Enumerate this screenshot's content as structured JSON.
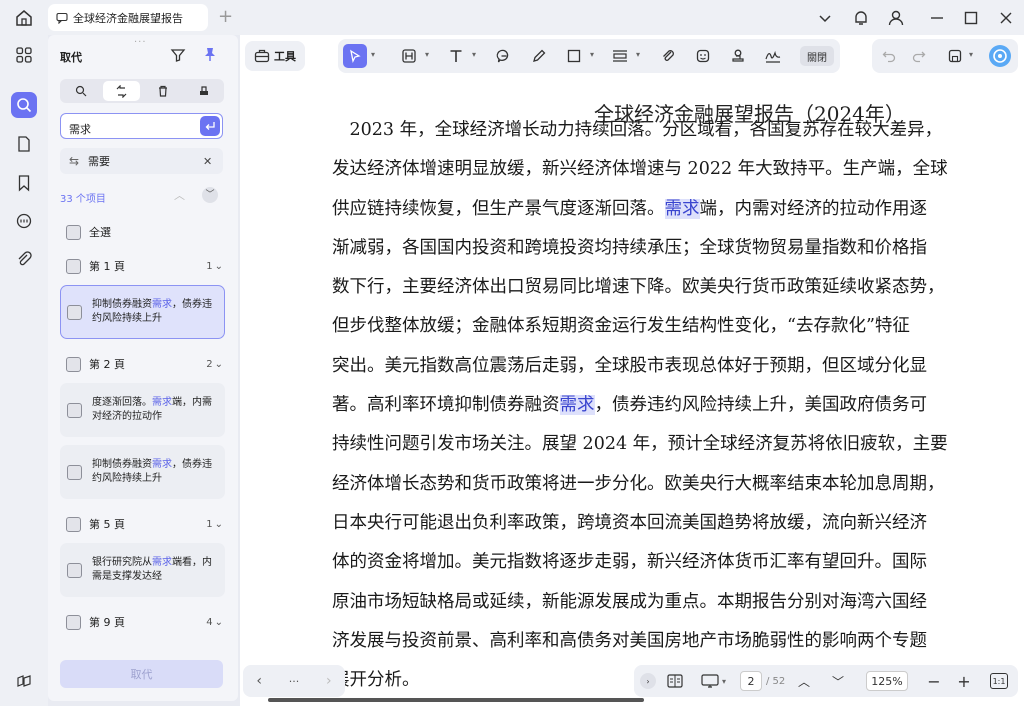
{
  "titlebar": {
    "tab_title": "全球经济金融展望报告",
    "new_tab": "+"
  },
  "panel": {
    "title": "取代",
    "search_value": "需求",
    "replace_value": "需要",
    "result_count": "33 个项目",
    "select_all": "全選",
    "replace_button": "取代",
    "groups": [
      {
        "page": "第 1 頁",
        "count": "1"
      },
      {
        "page": "第 2 頁",
        "count": "2"
      },
      {
        "page": "第 5 頁",
        "count": "1"
      },
      {
        "page": "第 9 頁",
        "count": "4"
      }
    ],
    "results": [
      {
        "before": "抑制债券融资",
        "match": "需求",
        "after": "，债券违约风险持续上升"
      },
      {
        "before": "度逐渐回落。",
        "match": "需求",
        "after": "端，内需对经济的拉动作"
      },
      {
        "before": "抑制债券融资",
        "match": "需求",
        "after": "，债券违约风险持续上升"
      },
      {
        "before": "银行研究院从",
        "match": "需求",
        "after": "端看，内需是支撑发达经"
      }
    ]
  },
  "toolbar": {
    "tool_label": "工具",
    "close_label": "關閉"
  },
  "document": {
    "cut_heading": "全球经济金融展望报告（2024年）",
    "lines": [
      "　2023 年，全球经济增长动力持续回落。分区域看，各国复苏存在较大差异，",
      "发达经济体增速明显放缓，新兴经济体增速与 2022 年大致持平。生产端，全球",
      "供应链持续恢复，但生产景气度逐渐回落。",
      "渐减弱，各国国内投资和跨境投资均持续承压；全球货物贸易量指数和价格指",
      "数下行，主要经济体出口贸易同比增速下降。欧美央行货币政策延续收紧态势，",
      "但步伐整体放缓；金融体系短期资金运行发生结构性变化，“去存款化”特征",
      "突出。美元指数高位震荡后走弱，全球股市表现总体好于预期，但区域分化显",
      "著。高利率环境抑制债券融资",
      "持续性问题引发市场关注。展望 2024 年，预计全球经济复苏将依旧疲软，主要",
      "经济体增长态势和货币政策将进一步分化。欧美央行大概率结束本轮加息周期，",
      "日本央行可能退出负利率政策，跨境资本回流美国趋势将放缓，流向新兴经济",
      "体的资金将增加。美元指数将逐步走弱，新兴经济体货币汇率有望回升。国际",
      "原油市场短缺格局或延续，新能源发展成为重点。本期报告分别对海湾六国经",
      "济发展与投资前景、高利率和高债务对美国房地产市场脆弱性的影响两个专题",
      "展开分析。"
    ],
    "match": "需求",
    "line3_after": "端，内需对经济的拉动作用逐",
    "line8_after": "，债券违约风险持续上升，美国政府债务可"
  },
  "bottombar": {
    "current_page": "2",
    "total_pages": "/ 52",
    "zoom": "125%",
    "more": "···"
  },
  "colors": {
    "accent": "#6b73f2",
    "highlight": "#dde0fb"
  }
}
